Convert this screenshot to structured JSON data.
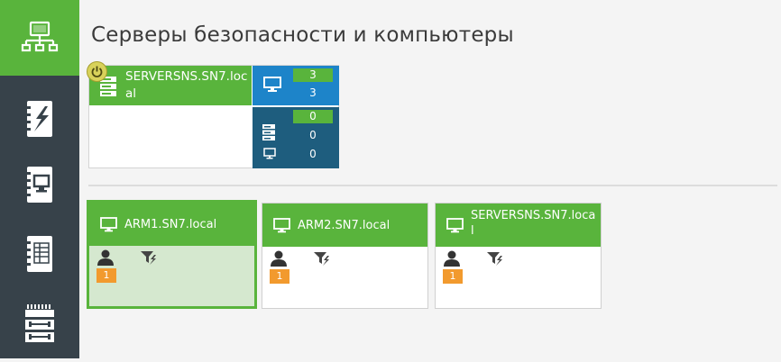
{
  "title": "Серверы безопасности и компьютеры",
  "colors": {
    "accent": "#59b43c",
    "sidebar": "#37424a",
    "blue": "#1d84c9",
    "dark_blue": "#1e5d7e",
    "badge": "#f29a2e"
  },
  "sidebar": {
    "items": [
      {
        "icon": "network-icon",
        "active": true
      },
      {
        "icon": "events-log-icon",
        "active": false
      },
      {
        "icon": "computer-book-icon",
        "active": false
      },
      {
        "icon": "ledger-book-icon",
        "active": false
      },
      {
        "icon": "switch-device-icon",
        "active": false
      }
    ]
  },
  "server": {
    "name": "SERVERSNS.SN7.local",
    "computers_online": "3",
    "computers_total": "3",
    "servers_online": "0",
    "servers_total": "0",
    "clients_total": "0"
  },
  "computers": [
    {
      "name": "ARM1.SN7.local",
      "users": "1",
      "selected": true
    },
    {
      "name": "ARM2.SN7.local",
      "users": "1",
      "selected": false
    },
    {
      "name": "SERVERSNS.SN7.local",
      "users": "1",
      "selected": false
    }
  ]
}
